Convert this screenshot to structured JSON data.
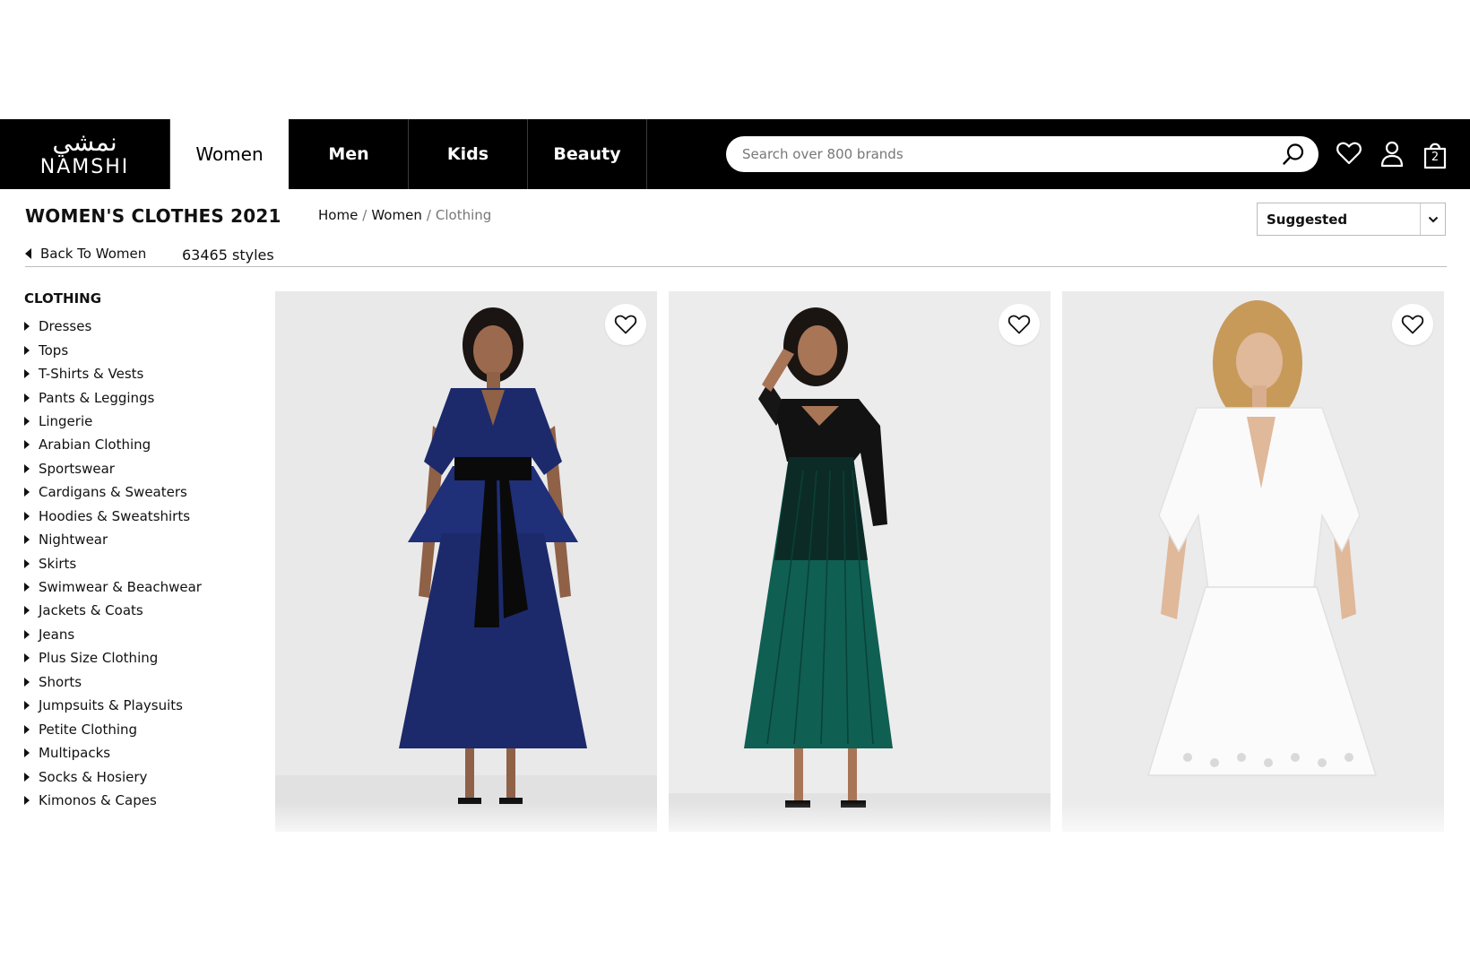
{
  "logo": {
    "arabic": "نمشي",
    "latin": "NAMSHI"
  },
  "nav": {
    "tabs": [
      {
        "label": "Women",
        "active": true
      },
      {
        "label": "Men"
      },
      {
        "label": "Kids"
      },
      {
        "label": "Beauty"
      }
    ],
    "search_placeholder": "Search over 800 brands",
    "bag_count": "2",
    "icons": [
      "search-icon",
      "heart-icon",
      "user-icon",
      "bag-icon"
    ]
  },
  "page": {
    "title": "WOMEN'S CLOTHES 2021",
    "breadcrumb": {
      "home": "Home",
      "women": "Women",
      "current": "Clothing"
    },
    "back_label": "Back To Women",
    "style_count": "63465 styles",
    "sort_value": "Suggested"
  },
  "sidebar": {
    "title": "CLOTHING",
    "items": [
      "Dresses",
      "Tops",
      "T-Shirts & Vests",
      "Pants & Leggings",
      "Lingerie",
      "Arabian Clothing",
      "Sportswear",
      "Cardigans & Sweaters",
      "Hoodies & Sweatshirts",
      "Nightwear",
      "Skirts",
      "Swimwear & Beachwear",
      "Jackets & Coats",
      "Jeans",
      "Plus Size Clothing",
      "Shorts",
      "Jumpsuits & Playsuits",
      "Petite Clothing",
      "Multipacks",
      "Socks & Hosiery",
      "Kimonos & Capes"
    ]
  },
  "products": [
    {
      "dress_color": "#1c2a6b",
      "accent": "#000000"
    },
    {
      "dress_color": "#0f5f52",
      "accent": "#111111"
    },
    {
      "dress_color": "#fafafa",
      "accent": "#e6e6e6"
    }
  ],
  "colors": {
    "nav_bg": "#000000",
    "accent_text": "#111111",
    "muted": "#777777"
  }
}
